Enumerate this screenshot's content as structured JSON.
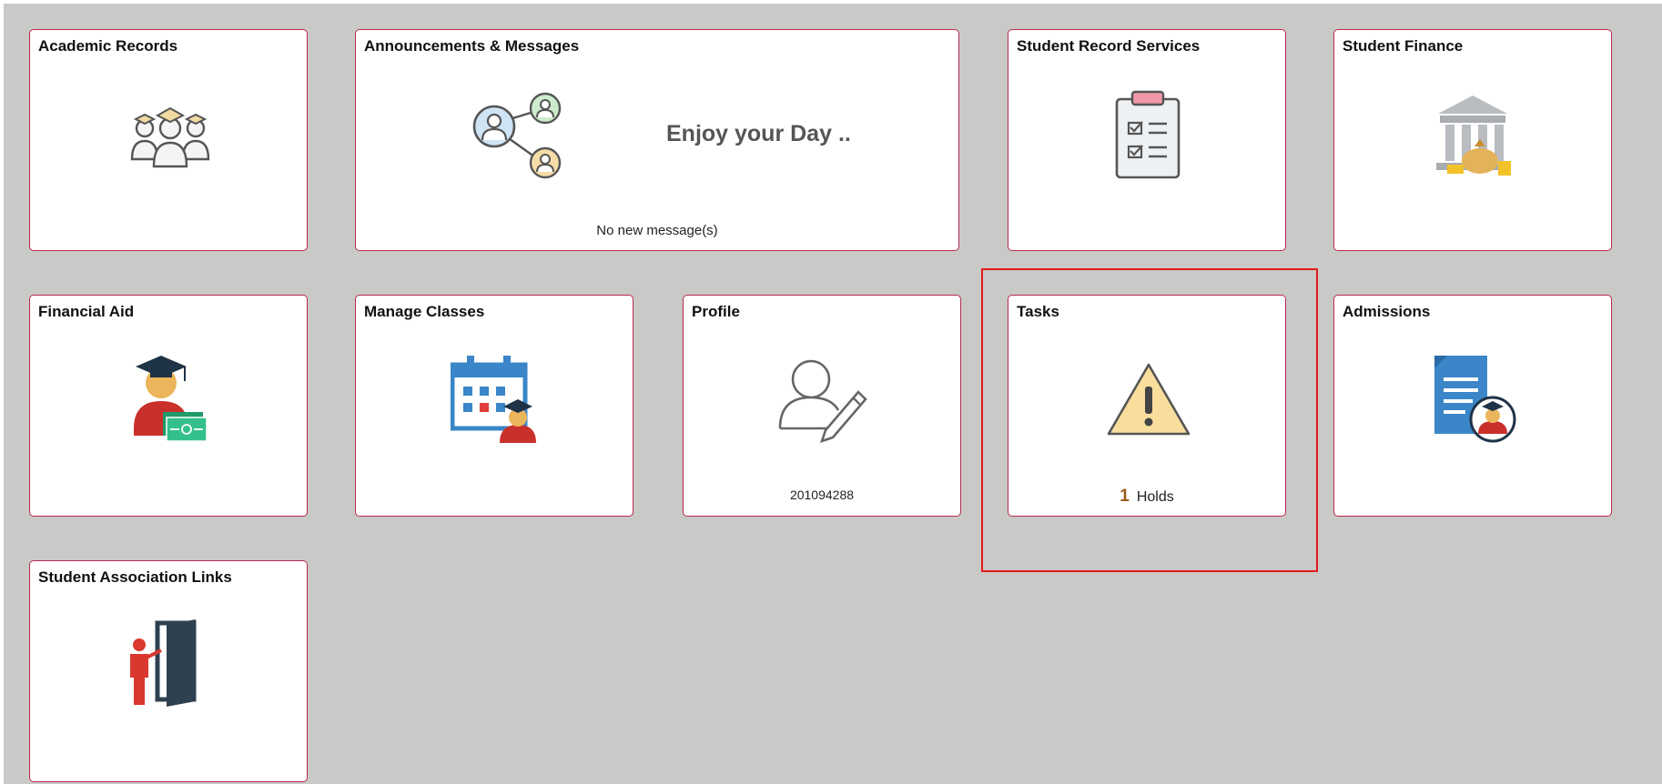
{
  "tiles": {
    "academic_records": {
      "title": "Academic Records",
      "icon": "students-icon"
    },
    "announcements": {
      "title": "Announcements & Messages",
      "icon": "people-network-icon",
      "banner": "Enjoy your Day ..",
      "status": "No new message(s)"
    },
    "student_record_services": {
      "title": "Student Record Services",
      "icon": "clipboard-checklist-icon"
    },
    "student_finance": {
      "title": "Student Finance",
      "icon": "bank-money-icon"
    },
    "financial_aid": {
      "title": "Financial Aid",
      "icon": "graduate-money-icon"
    },
    "manage_classes": {
      "title": "Manage Classes",
      "icon": "calendar-student-icon"
    },
    "profile": {
      "title": "Profile",
      "icon": "user-edit-icon",
      "id_number": "201094288"
    },
    "tasks": {
      "title": "Tasks",
      "icon": "warning-icon",
      "hold_count": "1",
      "hold_label": "Holds"
    },
    "admissions": {
      "title": "Admissions",
      "icon": "document-graduate-icon"
    },
    "student_association_links": {
      "title": "Student Association Links",
      "icon": "door-person-icon"
    }
  },
  "colors": {
    "background": "#c9c9c7",
    "tile_border": "#b9294f",
    "highlight": "#e01b1b"
  }
}
